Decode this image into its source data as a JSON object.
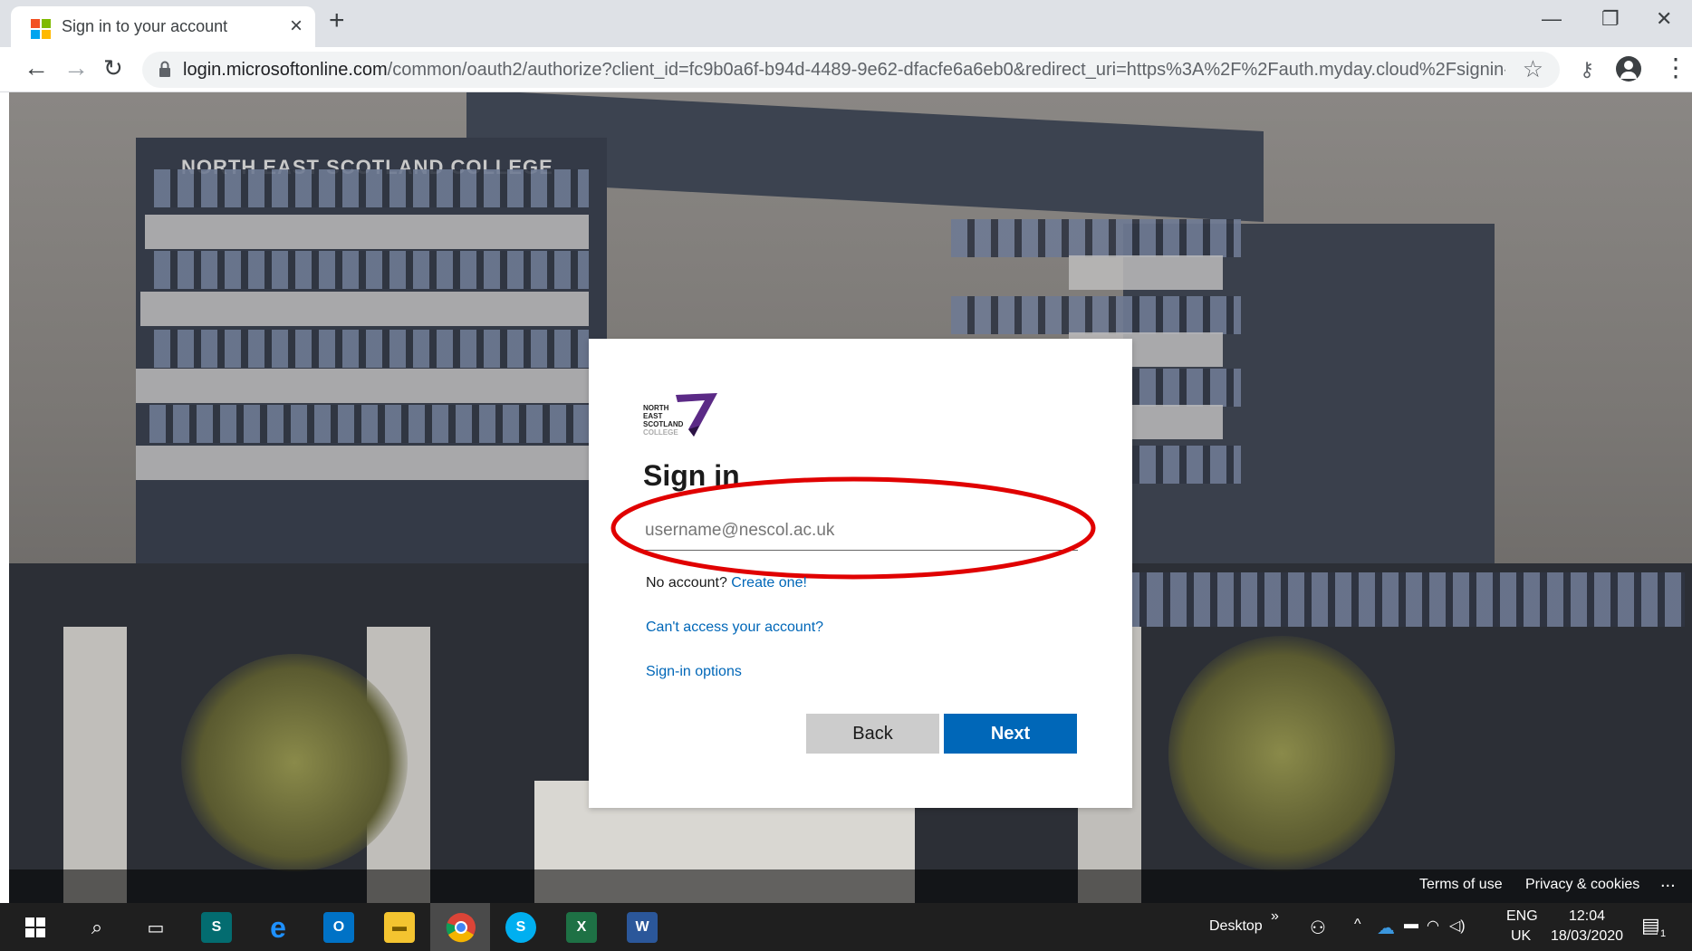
{
  "browser": {
    "tab_title": "Sign in to your account",
    "tab_close": "×",
    "new_tab": "+",
    "url_host": "login.microsoftonline.com",
    "url_rest": "/common/oauth2/authorize?client_id=fc9b0a6f-b94d-4489-9e62-dfacfe6a6eb0&redirect_uri=https%3A%2F%2Fauth.myday.cloud%2Fsignin-aad&...",
    "icons": [
      "back-icon",
      "forward-icon",
      "reload-icon",
      "lock-icon",
      "star-icon",
      "key-icon",
      "profile-icon",
      "menu-icon"
    ],
    "window_controls": {
      "minimize": "—",
      "restore": "❐",
      "close": "✕"
    }
  },
  "background": {
    "college_sign": "NORTH EAST SCOTLAND COLLEGE"
  },
  "signin": {
    "logo_lines": [
      "NORTH EAST",
      "SCOTLAND",
      "COLLEGE"
    ],
    "title": "Sign in",
    "email_placeholder": "username@nescol.ac.uk",
    "no_account_text": "No account?",
    "create_link": "Create one!",
    "cant_access": "Can't access your account?",
    "signin_options": "Sign-in options",
    "back_button": "Back",
    "next_button": "Next",
    "highlight_color": "#e00000",
    "primary_color": "#0067b8"
  },
  "footer": {
    "terms": "Terms of use",
    "privacy": "Privacy & cookies",
    "more": "..."
  },
  "taskbar": {
    "desktop_label": "Desktop",
    "chevron": "»",
    "language_top": "ENG",
    "language_bottom": "UK",
    "time": "12:04",
    "date": "18/03/2020",
    "notification_count": "1",
    "apps": [
      "start-icon",
      "search-icon",
      "task-view-icon",
      "sharepoint-icon",
      "edge-icon",
      "outlook-icon",
      "file-explorer-icon",
      "chrome-icon",
      "skype-icon",
      "excel-icon",
      "word-icon"
    ]
  }
}
